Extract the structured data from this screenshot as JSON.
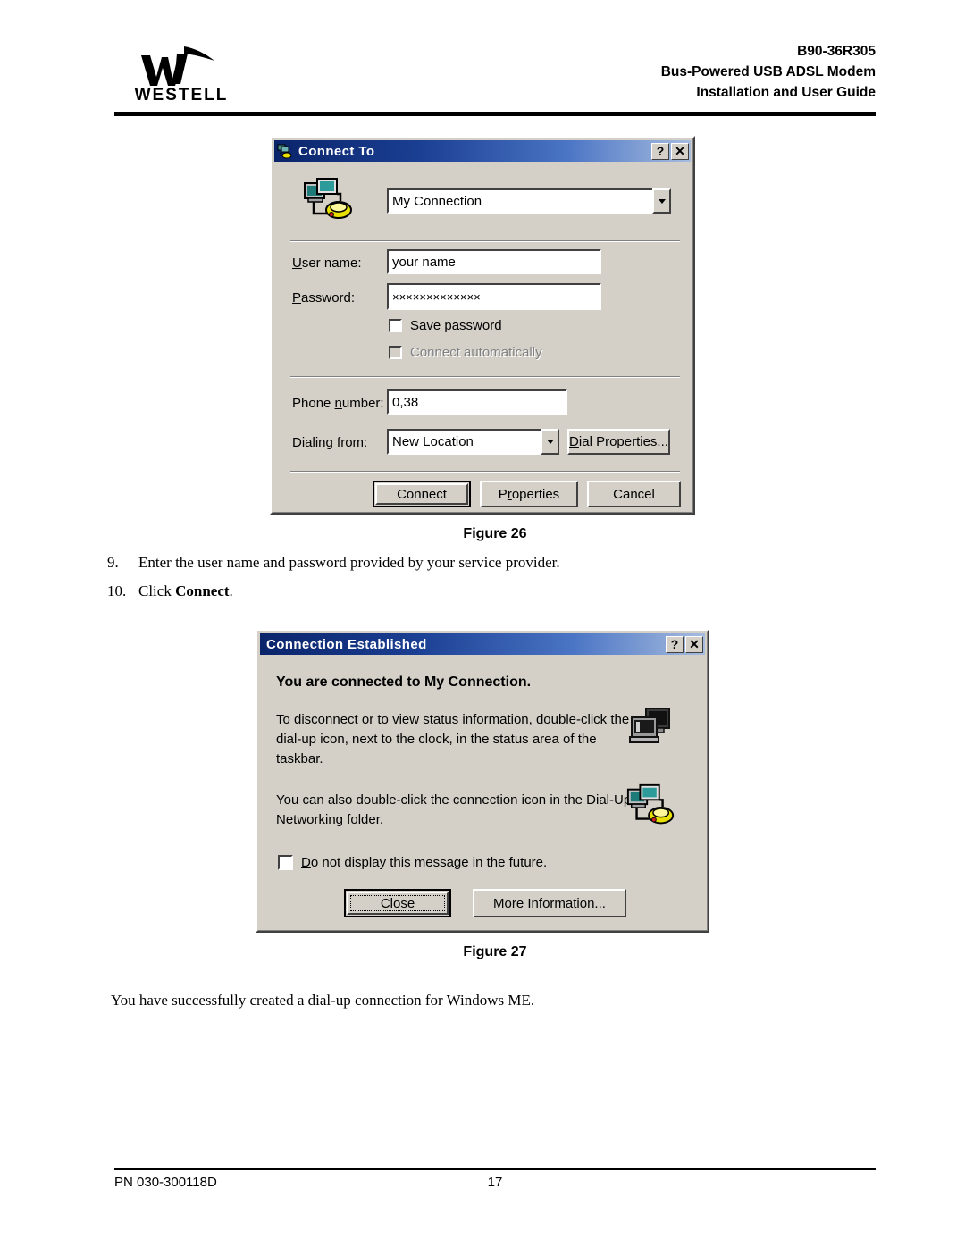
{
  "header": {
    "logo_wordmark": "WESTELL",
    "doc_number": "B90-36R305",
    "product_line": "Bus-Powered USB ADSL Modem",
    "doc_subtitle": "Installation and User Guide"
  },
  "figure26": {
    "caption": "Figure  26",
    "dialog": {
      "title": "Connect To",
      "help_button": "?",
      "close_button": "✕",
      "connection_combo_value": "My Connection",
      "username_label": "User name:",
      "username_value": "your name",
      "password_label": "Password:",
      "password_value": "×××××××××××××",
      "save_password_label": "Save password",
      "connect_automatically_label": "Connect automatically",
      "phone_number_label": "Phone number:",
      "phone_number_value": "0,38",
      "dialing_from_label": "Dialing from:",
      "dialing_from_value": "New Location",
      "dial_properties_button": "Dial Properties...",
      "connect_button": "Connect",
      "properties_button": "Properties",
      "cancel_button": "Cancel"
    }
  },
  "steps": [
    {
      "number": "9.",
      "text": "Enter the user name and password provided by your service provider."
    },
    {
      "number": "10.",
      "text_before": "Click ",
      "bold": "Connect",
      "text_after": "."
    }
  ],
  "figure27": {
    "caption": "Figure  27",
    "dialog": {
      "title": "Connection Established",
      "help_button": "?",
      "close_button": "✕",
      "heading": "You are connected to My Connection.",
      "paragraph1_line1": "To disconnect or to view status information, double-click the",
      "paragraph1_line2": "dial-up icon, next to the clock, in the status area of the",
      "paragraph1_line3": "taskbar.",
      "paragraph2_line1": "You can also double-click the connection icon in the Dial-Up",
      "paragraph2_line2": "Networking folder.",
      "do_not_display_label": "Do not display this message in the future.",
      "close_label": "Close",
      "more_information_label": "More Information..."
    }
  },
  "closing_text": "You have successfully created a dial-up connection for Windows ME.",
  "footer": {
    "part_number": "PN 030-300118D",
    "page_number": "17"
  },
  "colors": {
    "dialog_face": "#d4d0c8",
    "titlebar_start": "#0a246a",
    "titlebar_end": "#a6bcdf",
    "field_white": "#ffffff",
    "modem_yellow": "#e8e000"
  }
}
